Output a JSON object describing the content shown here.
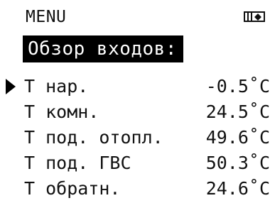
{
  "header": {
    "menu_label": "MENU",
    "panel_icon": "display-mode-icon"
  },
  "title": "Обзор входов:",
  "rows": [
    {
      "label": "T нар.",
      "value": "-0.5˚C",
      "selected": true
    },
    {
      "label": "T комн.",
      "value": "24.5˚C",
      "selected": false
    },
    {
      "label": "T под. отопл.",
      "value": "49.6˚C",
      "selected": false
    },
    {
      "label": "T под. ГВС",
      "value": "50.3˚C",
      "selected": false
    },
    {
      "label": "T обратн.",
      "value": "24.6˚C",
      "selected": false
    }
  ],
  "colors": {
    "background": "#ffffff",
    "foreground": "#111111",
    "highlight_bg": "#000000",
    "highlight_fg": "#ffffff"
  }
}
